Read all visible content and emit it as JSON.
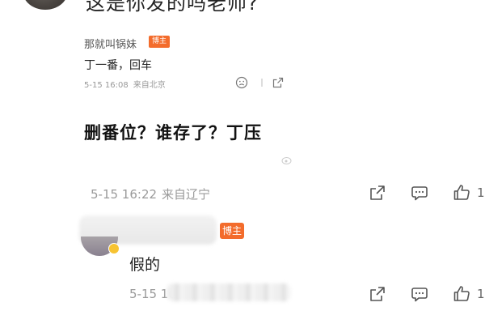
{
  "top_comment": {
    "text": "这是你发的吗老师?"
  },
  "embedded_card": {
    "author": "那就叫锅妹",
    "author_badge": "博主",
    "text": "丁一番，回车",
    "time": "5-15 16:08",
    "location": "来自北京",
    "headline": "删番位？谁存了？丁压"
  },
  "comment_meta": {
    "time": "5-15 16:22",
    "location": "来自辽宁",
    "like_count": "1"
  },
  "reply": {
    "author_badge": "博主",
    "text": "假的",
    "time": "5-15 16",
    "like_count": "1"
  },
  "colors": {
    "badge": "#f36c2c",
    "meta_gray": "#9a9a9a",
    "verified": "#f7c331"
  }
}
